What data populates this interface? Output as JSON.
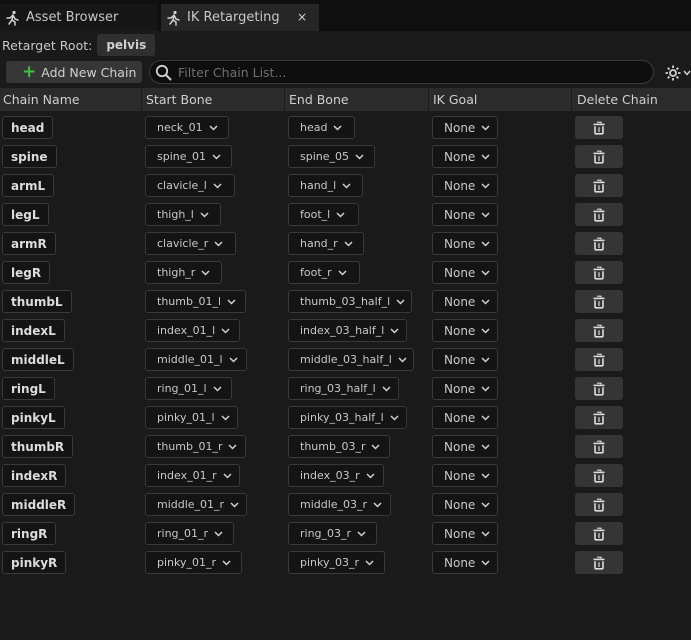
{
  "tabs": [
    {
      "label": "Asset Browser",
      "icon": "running-figure-icon",
      "active": false
    },
    {
      "label": "IK Retargeting",
      "icon": "running-figure-icon",
      "active": true,
      "close": "×"
    }
  ],
  "retarget_root": {
    "label": "Retarget Root:",
    "value": "pelvis"
  },
  "toolbar": {
    "add_label": "Add New Chain",
    "search_placeholder": "Filter Chain List...",
    "settings_icon": "gear-icon"
  },
  "columns": [
    "Chain Name",
    "Start Bone",
    "End Bone",
    "IK Goal",
    "Delete Chain"
  ],
  "chains": [
    {
      "name": "head",
      "start": "neck_01",
      "end": "head",
      "goal": "None"
    },
    {
      "name": "spine",
      "start": "spine_01",
      "end": "spine_05",
      "goal": "None"
    },
    {
      "name": "armL",
      "start": "clavicle_l",
      "end": "hand_l",
      "goal": "None"
    },
    {
      "name": "legL",
      "start": "thigh_l",
      "end": "foot_l",
      "goal": "None"
    },
    {
      "name": "armR",
      "start": "clavicle_r",
      "end": "hand_r",
      "goal": "None"
    },
    {
      "name": "legR",
      "start": "thigh_r",
      "end": "foot_r",
      "goal": "None"
    },
    {
      "name": "thumbL",
      "start": "thumb_01_l",
      "end": "thumb_03_half_l",
      "goal": "None"
    },
    {
      "name": "indexL",
      "start": "index_01_l",
      "end": "index_03_half_l",
      "goal": "None"
    },
    {
      "name": "middleL",
      "start": "middle_01_l",
      "end": "middle_03_half_l",
      "goal": "None"
    },
    {
      "name": "ringL",
      "start": "ring_01_l",
      "end": "ring_03_half_l",
      "goal": "None"
    },
    {
      "name": "pinkyL",
      "start": "pinky_01_l",
      "end": "pinky_03_half_l",
      "goal": "None"
    },
    {
      "name": "thumbR",
      "start": "thumb_01_r",
      "end": "thumb_03_r",
      "goal": "None"
    },
    {
      "name": "indexR",
      "start": "index_01_r",
      "end": "index_03_r",
      "goal": "None"
    },
    {
      "name": "middleR",
      "start": "middle_01_r",
      "end": "middle_03_r",
      "goal": "None"
    },
    {
      "name": "ringR",
      "start": "ring_01_r",
      "end": "ring_03_r",
      "goal": "None"
    },
    {
      "name": "pinkyR",
      "start": "pinky_01_r",
      "end": "pinky_03_r",
      "goal": "None"
    }
  ],
  "delete_icon": "trash-icon",
  "colors": {
    "background": "#1a1a1a",
    "tabbar": "#0f0f0f",
    "active_tab": "#262626",
    "header": "#2b2b2b",
    "add_plus": "#3fbf3f"
  }
}
